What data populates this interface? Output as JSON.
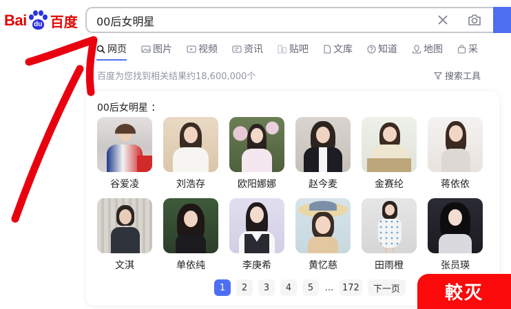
{
  "logo": {
    "left": "Bai",
    "paw": "du",
    "right": "百度"
  },
  "search": {
    "query": "00后女明星"
  },
  "tabs": [
    {
      "label": "网页",
      "icon": "search-icon"
    },
    {
      "label": "图片",
      "icon": "image-icon"
    },
    {
      "label": "视频",
      "icon": "video-icon"
    },
    {
      "label": "资讯",
      "icon": "news-icon"
    },
    {
      "label": "贴吧",
      "icon": "tieba-icon"
    },
    {
      "label": "文库",
      "icon": "document-icon"
    },
    {
      "label": "知道",
      "icon": "question-icon"
    },
    {
      "label": "地图",
      "icon": "map-icon"
    },
    {
      "label": "采",
      "icon": "bag-icon"
    }
  ],
  "stats": "百度为您找到相关结果约18,600,000个",
  "search_tools": "搜索工具",
  "card": {
    "title": "00后女明星 ：",
    "people": [
      {
        "name": "谷爱凌"
      },
      {
        "name": "刘浩存"
      },
      {
        "name": "欧阳娜娜"
      },
      {
        "name": "赵今麦"
      },
      {
        "name": "金赛纶"
      },
      {
        "name": "蒋依依"
      },
      {
        "name": "文淇"
      },
      {
        "name": "单依纯"
      },
      {
        "name": "李庚希"
      },
      {
        "name": "黄忆慈"
      },
      {
        "name": "田雨橙"
      },
      {
        "name": "张员瑛"
      }
    ]
  },
  "pager": {
    "pages": [
      "1",
      "2",
      "3",
      "4",
      "5"
    ],
    "dots": "...",
    "last": "172",
    "next": "下一页"
  },
  "stamp": "較灭",
  "colors": {
    "accent": "#4e6ef2",
    "brand_red": "#e10602",
    "arrow_red": "#e8000f"
  }
}
